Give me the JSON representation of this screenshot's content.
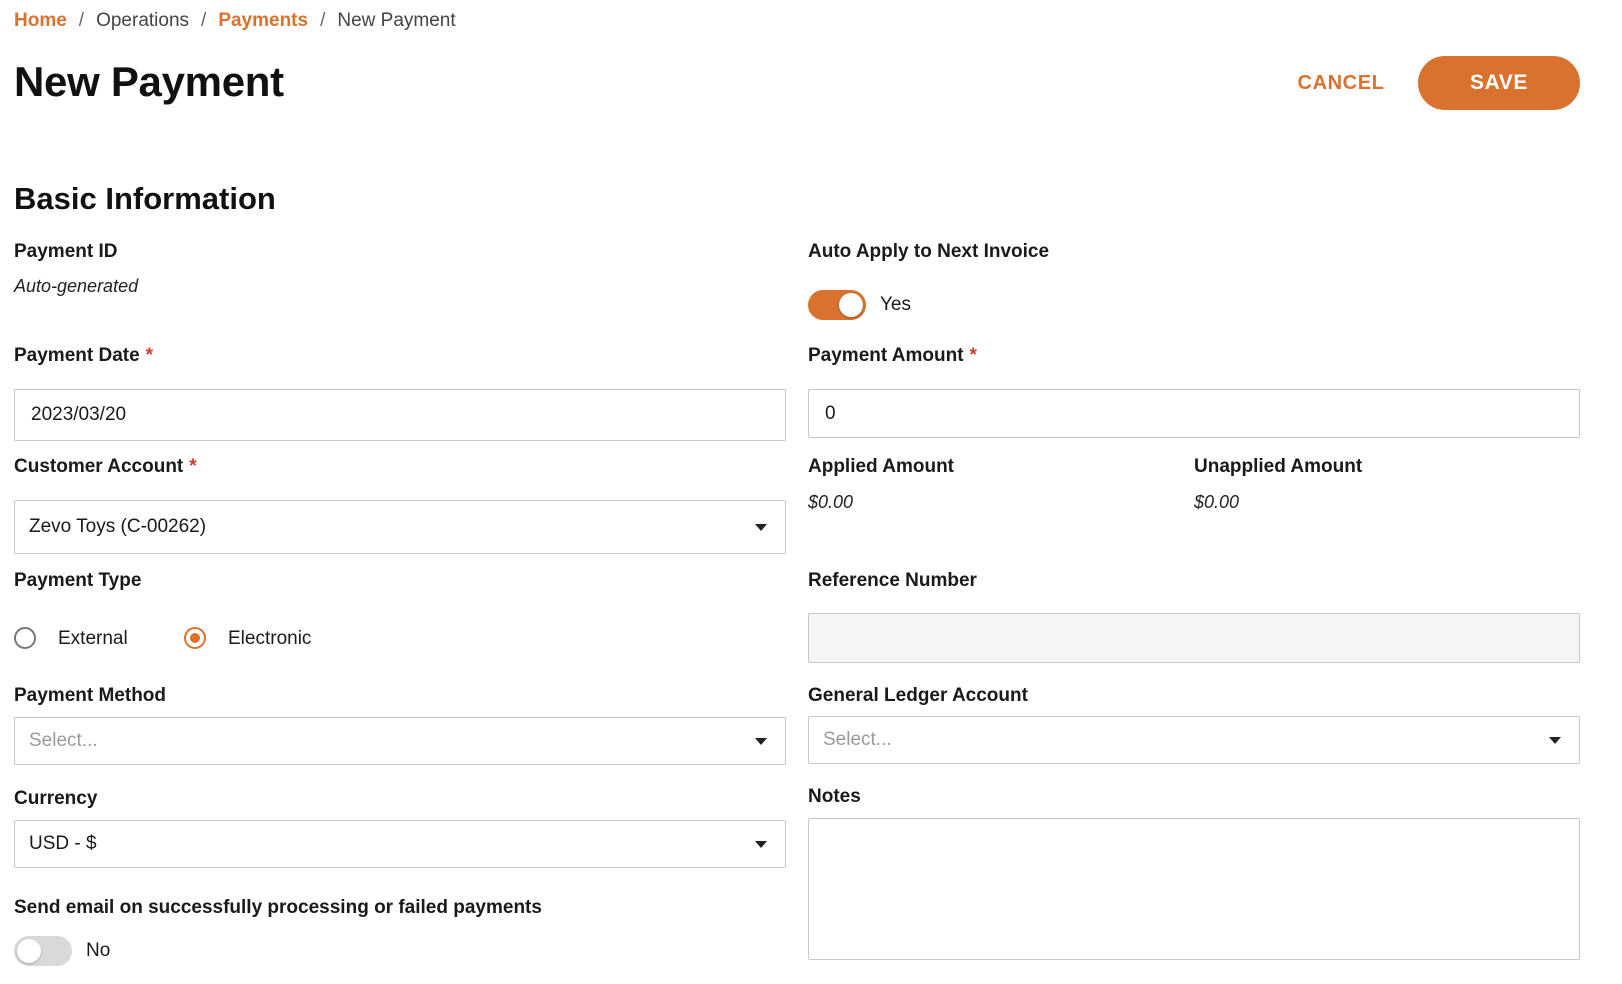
{
  "breadcrumb": {
    "home": "Home",
    "operations": "Operations",
    "payments": "Payments",
    "current": "New Payment",
    "separator": "/"
  },
  "header": {
    "title": "New Payment",
    "cancel_label": "CANCEL",
    "save_label": "SAVE"
  },
  "section": {
    "title": "Basic Information"
  },
  "form": {
    "payment_id": {
      "label": "Payment ID",
      "value": "Auto-generated"
    },
    "auto_apply": {
      "label": "Auto Apply to Next Invoice",
      "state_label": "Yes",
      "on": true
    },
    "payment_date": {
      "label": "Payment Date",
      "required_mark": "*",
      "value": "2023/03/20"
    },
    "payment_amount": {
      "label": "Payment Amount",
      "required_mark": "*",
      "value": "0"
    },
    "customer_account": {
      "label": "Customer Account",
      "required_mark": "*",
      "value": "Zevo Toys (C-00262)"
    },
    "applied_amount": {
      "label": "Applied Amount",
      "value": "$0.00"
    },
    "unapplied_amount": {
      "label": "Unapplied Amount",
      "value": "$0.00"
    },
    "payment_type": {
      "label": "Payment Type",
      "options": [
        {
          "label": "External",
          "checked": false
        },
        {
          "label": "Electronic",
          "checked": true
        }
      ]
    },
    "reference_number": {
      "label": "Reference Number",
      "value": ""
    },
    "payment_method": {
      "label": "Payment Method",
      "placeholder": "Select..."
    },
    "general_ledger_account": {
      "label": "General Ledger Account",
      "placeholder": "Select..."
    },
    "currency": {
      "label": "Currency",
      "value": "USD - $"
    },
    "notes": {
      "label": "Notes",
      "value": ""
    },
    "send_email": {
      "label": "Send email on successfully processing or failed payments",
      "state_label": "No",
      "on": false
    }
  },
  "colors": {
    "accent": "#d9722e",
    "required": "#d23a2a",
    "border": "#c8c8c8"
  }
}
